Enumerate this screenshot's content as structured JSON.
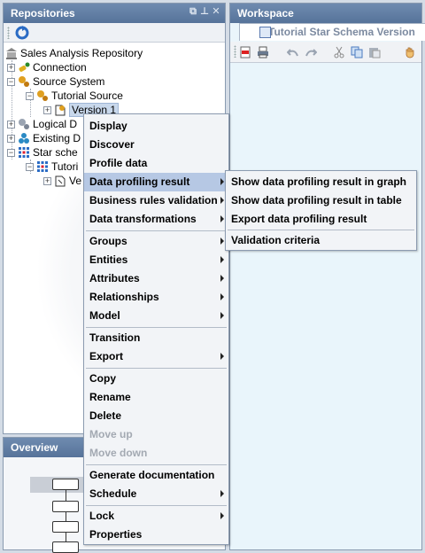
{
  "repositories": {
    "title": "Repositories",
    "tree": {
      "root": "Sales Analysis Repository",
      "connection": "Connection",
      "source_system": "Source System",
      "tutorial_source": "Tutorial Source",
      "version1": "Version 1",
      "logical": "Logical D",
      "existing": "Existing D",
      "star_schema": "Star sche",
      "tutorial_star": "Tutori",
      "star_version": "Ve"
    }
  },
  "overview": {
    "title": "Overview"
  },
  "workspace": {
    "title": "Workspace",
    "tab_label": "Tutorial Star Schema Version"
  },
  "context_menu": {
    "display": "Display",
    "discover": "Discover",
    "profile_data": "Profile data",
    "data_profiling_result": "Data profiling result",
    "business_rules_validation": "Business rules validation",
    "data_transformations": "Data transformations",
    "groups": "Groups",
    "entities": "Entities",
    "attributes": "Attributes",
    "relationships": "Relationships",
    "model": "Model",
    "transition": "Transition",
    "export": "Export",
    "copy": "Copy",
    "rename": "Rename",
    "delete": "Delete",
    "move_up": "Move up",
    "move_down": "Move down",
    "generate_documentation": "Generate documentation",
    "schedule": "Schedule",
    "lock": "Lock",
    "properties": "Properties"
  },
  "submenu": {
    "show_graph": "Show data profiling result in graph",
    "show_table": "Show data profiling result in table",
    "export_result": "Export data profiling result",
    "validation_criteria": "Validation criteria"
  },
  "colors": {
    "header": "#5f7ca4",
    "menu_highlight": "#b6c8e4",
    "workspace_bg": "#e9f5fb"
  }
}
